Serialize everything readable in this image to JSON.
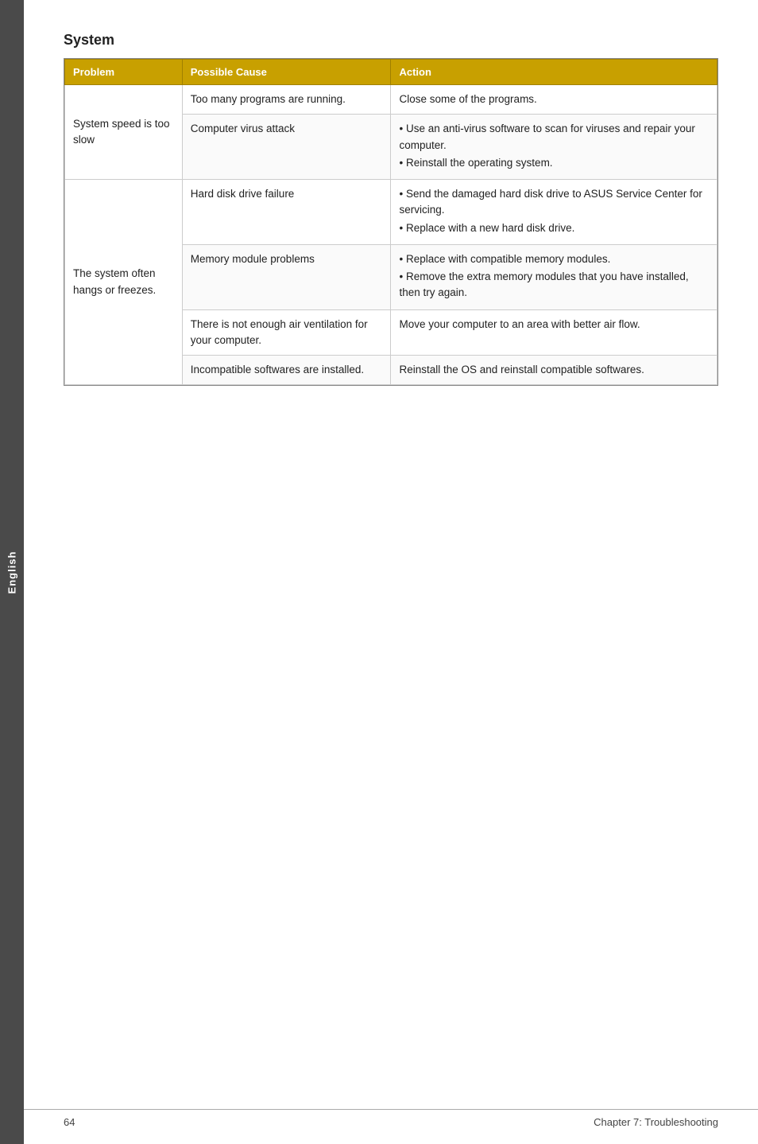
{
  "sidebar": {
    "label": "English"
  },
  "section": {
    "title": "System"
  },
  "table": {
    "headers": {
      "problem": "Problem",
      "cause": "Possible Cause",
      "action": "Action"
    },
    "rows": [
      {
        "problem": "System speed is too slow",
        "cause": "Too many programs are running.",
        "action_text": "Close some of the programs.",
        "action_bullets": []
      },
      {
        "problem": "",
        "cause": "Computer virus attack",
        "action_text": "",
        "action_bullets": [
          "Use an anti-virus software to scan for viruses and repair your computer.",
          "Reinstall the operating system."
        ]
      },
      {
        "problem": "The system often hangs or freezes.",
        "cause": "Hard disk drive failure",
        "action_text": "",
        "action_bullets": [
          "Send the damaged hard disk drive to ASUS Service Center for servicing.",
          "Replace with a new hard disk drive."
        ]
      },
      {
        "problem": "",
        "cause": "Memory module problems",
        "action_text": "",
        "action_bullets": [
          "Replace with compatible memory modules.",
          "Remove the extra memory modules that you have installed, then try again."
        ]
      },
      {
        "problem": "",
        "cause": "There is not enough air ventilation for your computer.",
        "action_text": "Move your computer to an area with better air flow.",
        "action_bullets": []
      },
      {
        "problem": "",
        "cause": "Incompatible softwares are installed.",
        "action_text": "Reinstall the OS and reinstall compatible softwares.",
        "action_bullets": []
      }
    ]
  },
  "footer": {
    "page_number": "64",
    "chapter": "Chapter 7: Troubleshooting"
  }
}
